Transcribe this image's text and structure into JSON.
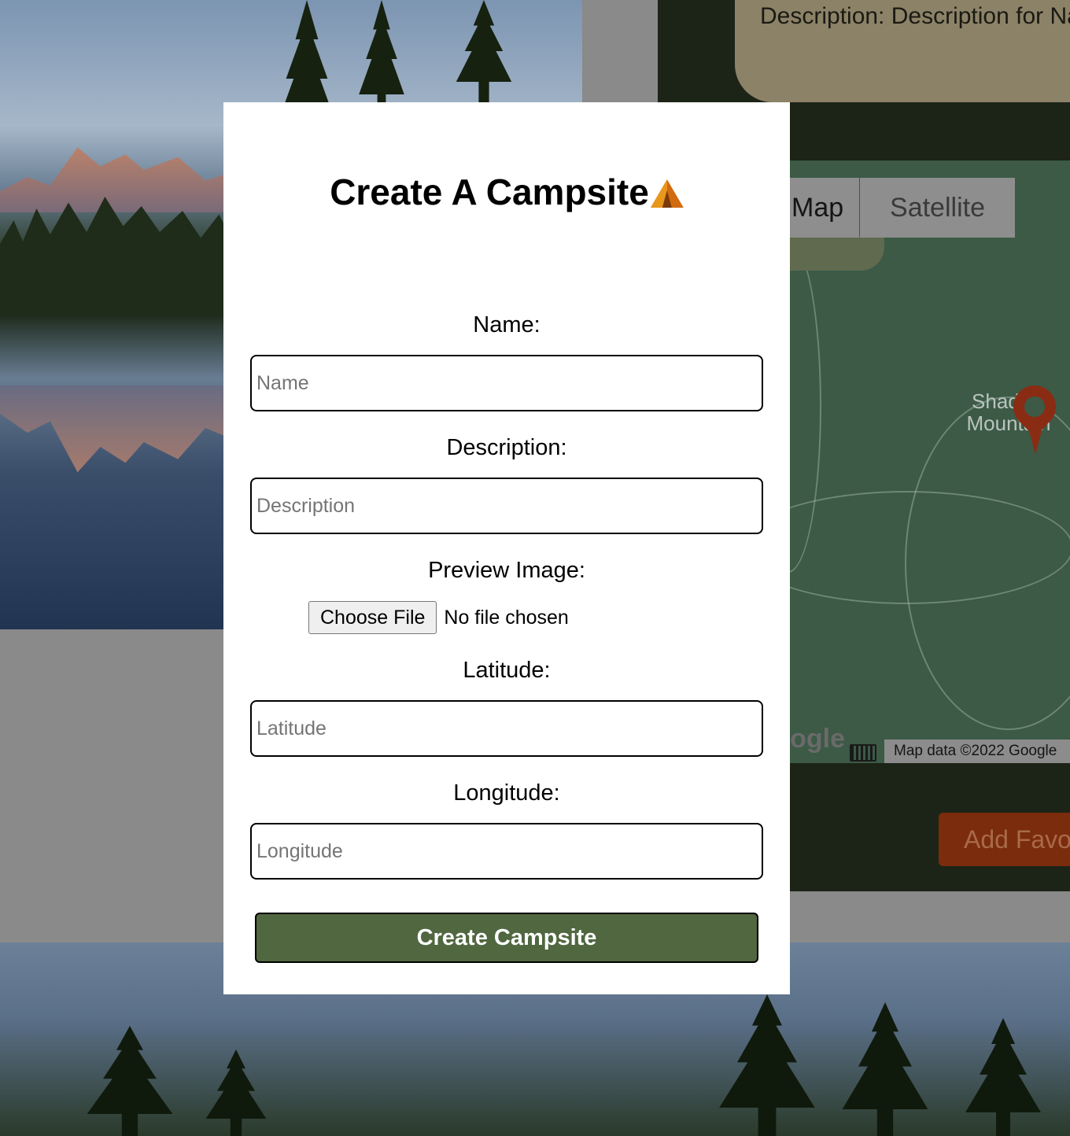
{
  "background": {
    "place_description": "Description: Description for National Park",
    "map": {
      "map_button": "Map",
      "satellite_button": "Satellite",
      "place_label": "Shadow Mountain",
      "google_logo": "Google",
      "attribution": "Map data ©2022 Google"
    },
    "favorite_button": "Add Favorite"
  },
  "modal": {
    "title": "Create A Campsite",
    "title_icon": "tent-icon",
    "fields": {
      "name": {
        "label": "Name:",
        "placeholder": "Name"
      },
      "description": {
        "label": "Description:",
        "placeholder": "Description"
      },
      "preview_image": {
        "label": "Preview Image:",
        "button": "Choose File",
        "status": "No file chosen"
      },
      "latitude": {
        "label": "Latitude:",
        "placeholder": "Latitude"
      },
      "longitude": {
        "label": "Longitude:",
        "placeholder": "Longitude"
      }
    },
    "submit": "Create Campsite"
  },
  "colors": {
    "submit_button": "#506740",
    "overlay": "#8a8a8a"
  }
}
